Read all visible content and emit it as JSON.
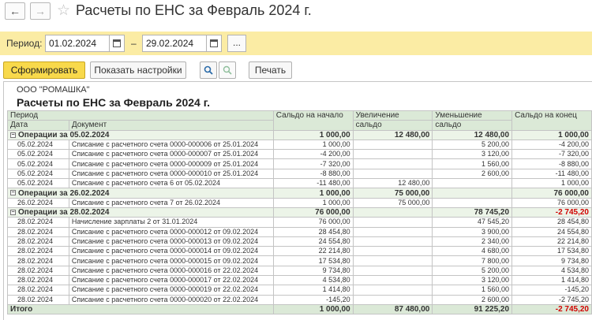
{
  "window": {
    "title": "Расчеты по ЕНС за Февраль 2024 г."
  },
  "params": {
    "period_label": "Период:",
    "date_from": "01.02.2024",
    "dash": "–",
    "date_to": "29.02.2024",
    "more": "..."
  },
  "toolbar": {
    "generate": "Сформировать",
    "show_settings": "Показать настройки",
    "print": "Печать"
  },
  "report": {
    "org": "ООО \"РОМАШКА\"",
    "title": "Расчеты по ЕНС за Февраль 2024 г.",
    "headers": {
      "period": "Период",
      "date": "Дата",
      "document": "Документ",
      "opening": "Сальдо на начало",
      "increase_1": "Увеличение",
      "increase_2": "сальдо",
      "decrease_1": "Уменьшение",
      "decrease_2": "сальдо",
      "closing": "Сальдо на конец"
    },
    "groups": [
      {
        "label": "Операции за 05.02.2024",
        "opening": "1 000,00",
        "increase": "12 480,00",
        "decrease": "12 480,00",
        "closing": "1 000,00",
        "closing_negative": false,
        "rows": [
          {
            "date": "05.02.2024",
            "doc": "Списание с расчетного счета 0000-000006 от 25.01.2024",
            "opening": "1 000,00",
            "increase": "",
            "decrease": "5 200,00",
            "closing": "-4 200,00"
          },
          {
            "date": "05.02.2024",
            "doc": "Списание с расчетного счета 0000-000007 от 25.01.2024",
            "opening": "-4 200,00",
            "increase": "",
            "decrease": "3 120,00",
            "closing": "-7 320,00"
          },
          {
            "date": "05.02.2024",
            "doc": "Списание с расчетного счета 0000-000009 от 25.01.2024",
            "opening": "-7 320,00",
            "increase": "",
            "decrease": "1 560,00",
            "closing": "-8 880,00"
          },
          {
            "date": "05.02.2024",
            "doc": "Списание с расчетного счета 0000-000010 от 25.01.2024",
            "opening": "-8 880,00",
            "increase": "",
            "decrease": "2 600,00",
            "closing": "-11 480,00"
          },
          {
            "date": "05.02.2024",
            "doc": "Списание с расчетного счета 6 от 05.02.2024",
            "opening": "-11 480,00",
            "increase": "12 480,00",
            "decrease": "",
            "closing": "1 000,00"
          }
        ]
      },
      {
        "label": "Операции за 26.02.2024",
        "opening": "1 000,00",
        "increase": "75 000,00",
        "decrease": "",
        "closing": "76 000,00",
        "closing_negative": false,
        "rows": [
          {
            "date": "26.02.2024",
            "doc": "Списание с расчетного счета 7 от 26.02.2024",
            "opening": "1 000,00",
            "increase": "75 000,00",
            "decrease": "",
            "closing": "76 000,00"
          }
        ]
      },
      {
        "label": "Операции за 28.02.2024",
        "opening": "76 000,00",
        "increase": "",
        "decrease": "78 745,20",
        "closing": "-2 745,20",
        "closing_negative": true,
        "rows": [
          {
            "date": "28.02.2024",
            "doc": "Начисление зарплаты 2 от 31.01.2024",
            "opening": "76 000,00",
            "increase": "",
            "decrease": "47 545,20",
            "closing": "28 454,80"
          },
          {
            "date": "28.02.2024",
            "doc": "Списание с расчетного счета 0000-000012 от 09.02.2024",
            "opening": "28 454,80",
            "increase": "",
            "decrease": "3 900,00",
            "closing": "24 554,80"
          },
          {
            "date": "28.02.2024",
            "doc": "Списание с расчетного счета 0000-000013 от 09.02.2024",
            "opening": "24 554,80",
            "increase": "",
            "decrease": "2 340,00",
            "closing": "22 214,80"
          },
          {
            "date": "28.02.2024",
            "doc": "Списание с расчетного счета 0000-000014 от 09.02.2024",
            "opening": "22 214,80",
            "increase": "",
            "decrease": "4 680,00",
            "closing": "17 534,80"
          },
          {
            "date": "28.02.2024",
            "doc": "Списание с расчетного счета 0000-000015 от 09.02.2024",
            "opening": "17 534,80",
            "increase": "",
            "decrease": "7 800,00",
            "closing": "9 734,80"
          },
          {
            "date": "28.02.2024",
            "doc": "Списание с расчетного счета 0000-000016 от 22.02.2024",
            "opening": "9 734,80",
            "increase": "",
            "decrease": "5 200,00",
            "closing": "4 534,80"
          },
          {
            "date": "28.02.2024",
            "doc": "Списание с расчетного счета 0000-000017 от 22.02.2024",
            "opening": "4 534,80",
            "increase": "",
            "decrease": "3 120,00",
            "closing": "1 414,80"
          },
          {
            "date": "28.02.2024",
            "doc": "Списание с расчетного счета 0000-000019 от 22.02.2024",
            "opening": "1 414,80",
            "increase": "",
            "decrease": "1 560,00",
            "closing": "-145,20"
          },
          {
            "date": "28.02.2024",
            "doc": "Списание с расчетного счета 0000-000020 от 22.02.2024",
            "opening": "-145,20",
            "increase": "",
            "decrease": "2 600,00",
            "closing": "-2 745,20"
          }
        ]
      }
    ],
    "total": {
      "label": "Итого",
      "opening": "1 000,00",
      "increase": "87 480,00",
      "decrease": "91 225,20",
      "closing": "-2 745,20"
    }
  }
}
